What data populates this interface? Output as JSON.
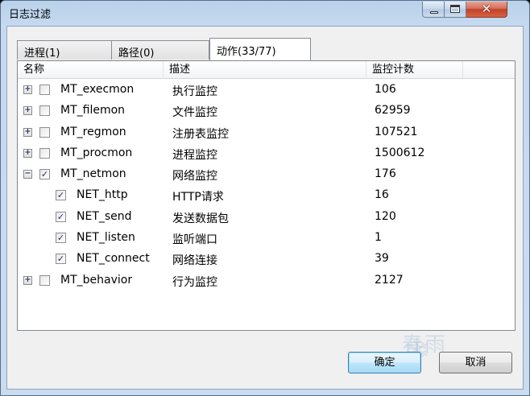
{
  "window": {
    "title": "日志过滤",
    "minimize_glyph": "",
    "maximize_glyph": "",
    "close_glyph": "✕"
  },
  "tabs": [
    {
      "label": "进程(1)"
    },
    {
      "label": "路径(0)"
    },
    {
      "label": "动作(33/77)"
    }
  ],
  "columns": [
    "名称",
    "描述",
    "监控计数",
    ""
  ],
  "rows": [
    {
      "expander": "+",
      "checked": "",
      "name": "MT_execmon",
      "desc": "执行监控",
      "count": "106"
    },
    {
      "expander": "+",
      "checked": "",
      "name": "MT_filemon",
      "desc": "文件监控",
      "count": "62959"
    },
    {
      "expander": "+",
      "checked": "",
      "name": "MT_regmon",
      "desc": "注册表监控",
      "count": "107521"
    },
    {
      "expander": "+",
      "checked": "",
      "name": "MT_procmon",
      "desc": "进程监控",
      "count": "1500612"
    },
    {
      "expander": "−",
      "checked": "✓",
      "name": "MT_netmon",
      "desc": "网络监控",
      "count": "176"
    },
    {
      "checked": "✓",
      "name": "NET_http",
      "desc": "HTTP请求",
      "count": "16"
    },
    {
      "checked": "✓",
      "name": "NET_send",
      "desc": "发送数据包",
      "count": "120"
    },
    {
      "checked": "✓",
      "name": "NET_listen",
      "desc": "监听端口",
      "count": "1"
    },
    {
      "checked": "✓",
      "name": "NET_connect",
      "desc": "网络连接",
      "count": "39"
    },
    {
      "expander": "+",
      "checked": "",
      "name": "MT_behavior",
      "desc": "行为监控",
      "count": "2127"
    }
  ],
  "buttons": {
    "ok": "确定",
    "cancel": "取消"
  },
  "watermark": {
    "text": "春雨",
    "flake": "❄"
  }
}
